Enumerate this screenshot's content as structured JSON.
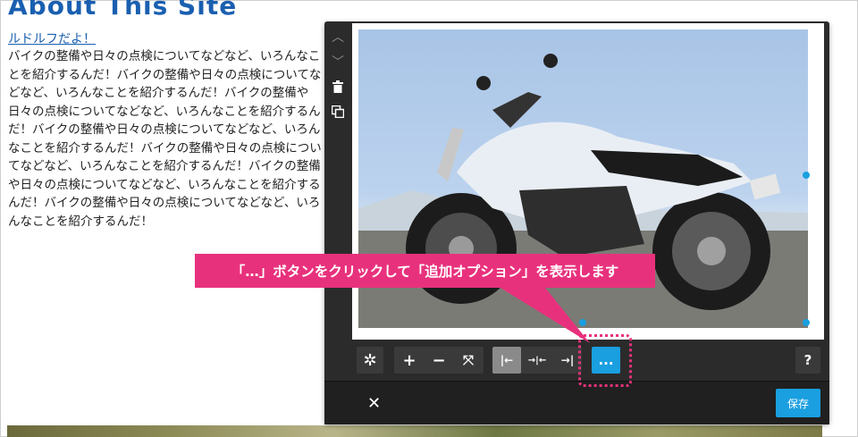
{
  "page": {
    "title": "About This Site",
    "subhead": "ルドルフだよ！",
    "body": "バイクの整備や日々の点検についてなどなど、いろんなことを紹介するんだ！バイクの整備や日々の点検についてなどなど、いろんなことを紹介するんだ！バイクの整備や日々の点検についてなどなど、いろんなことを紹介するんだ！バイクの整備や日々の点検についてなどなど、いろんなことを紹介するんだ！バイクの整備や日々の点検についてなどなど、いろんなことを紹介するんだ！バイクの整備や日々の点検についてなどなど、いろんなことを紹介するんだ！バイクの整備や日々の点検についてなどなど、いろんなことを紹介するんだ！"
  },
  "editor": {
    "side_tools": [
      "chevron-up-icon",
      "chevron-down-icon",
      "trash-icon",
      "copy-icon"
    ],
    "toolbar": {
      "buttons": [
        {
          "name": "aperture-icon",
          "glyph": "✲"
        },
        {
          "name": "zoom-in-button",
          "glyph": "+"
        },
        {
          "name": "zoom-out-button",
          "glyph": "−"
        },
        {
          "name": "fit-button",
          "glyph": "⤧"
        },
        {
          "name": "align-left-button",
          "glyph": "|←"
        },
        {
          "name": "align-center-button",
          "glyph": "→|←"
        },
        {
          "name": "align-right-button",
          "glyph": "→|"
        },
        {
          "name": "more-options-button",
          "glyph": "..."
        },
        {
          "name": "help-button",
          "glyph": "?"
        }
      ]
    },
    "close_label": "✕",
    "save_label": "保存"
  },
  "callout": {
    "text": "「…」ボタンをクリックして「追加オプション」を表示します"
  },
  "colors": {
    "accent": "#1a9fe0",
    "callout": "#e8317c",
    "title": "#1a5fb0"
  }
}
